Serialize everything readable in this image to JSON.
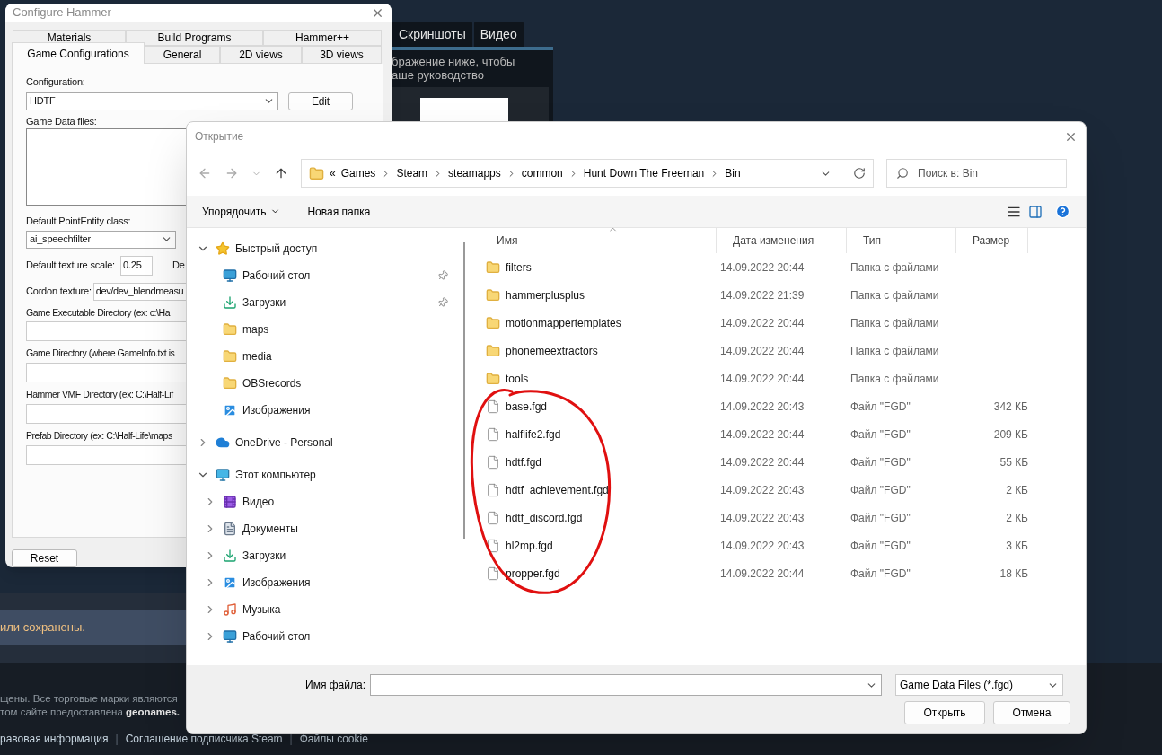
{
  "background_page": {
    "tabs": [
      {
        "label": "Скриншоты"
      },
      {
        "label": "Видео"
      }
    ],
    "hint_lines": [
      "бражение ниже, чтобы",
      "аше руководство"
    ],
    "notice": "или сохранены.",
    "footer_lines": [
      "щены. Все торговые марки являются",
      "том сайте предоставлена **geonames.**"
    ],
    "footer_links": [
      "равовая информация",
      "Соглашение подписчика Steam",
      "Файлы cookie"
    ],
    "separator": "|"
  },
  "hammer_window": {
    "title": "Configure Hammer",
    "tabs_row_1": [
      {
        "label": "Materials",
        "selected": false
      },
      {
        "label": "Build Programs",
        "selected": false
      },
      {
        "label": "Hammer++",
        "selected": false
      }
    ],
    "tabs_row_2": [
      {
        "label": "Game Configurations",
        "selected": true
      },
      {
        "label": "General",
        "selected": false
      },
      {
        "label": "2D views",
        "selected": false
      },
      {
        "label": "3D views",
        "selected": false
      }
    ],
    "configuration": {
      "label": "Configuration:",
      "value": "HDTF"
    },
    "edit_button": "Edit",
    "game_data_files_label": "Game Data files:",
    "point_entity": {
      "label": "Default PointEntity class:",
      "value": "ai_speechfilter"
    },
    "texture_scale": {
      "label": "Default texture scale:",
      "value": "0.25"
    },
    "next_label": "De",
    "cordon": {
      "label": "Cordon texture:",
      "value": "dev/dev_blendmeasu"
    },
    "directories": [
      {
        "label": "Game Executable Directory (ex: c:\\Ha"
      },
      {
        "label": "Game Directory (where GameInfo.txt is"
      },
      {
        "label": "Hammer VMF Directory (ex: C:\\Half-Lif"
      },
      {
        "label": "Prefab Directory (ex: C:\\Half-Life\\maps"
      }
    ],
    "reset_button": "Reset"
  },
  "dialog": {
    "title": "Открытие",
    "path_prefix": "«",
    "path": [
      "Games",
      "Steam",
      "steamapps",
      "common",
      "Hunt Down The Freeman",
      "Bin"
    ],
    "search_placeholder": "Поиск в: Bin",
    "organize": "Упорядочить",
    "new_folder": "Новая папка",
    "nav": [
      {
        "label": "Быстрый доступ",
        "kind": "star",
        "expanded": true,
        "children": [
          {
            "label": "Рабочий стол",
            "kind": "desktop",
            "pinned": true
          },
          {
            "label": "Загрузки",
            "kind": "download",
            "pinned": true
          },
          {
            "label": "maps",
            "kind": "folder",
            "pinned": false
          },
          {
            "label": "media",
            "kind": "folder",
            "pinned": false
          },
          {
            "label": "OBSrecords",
            "kind": "folder",
            "pinned": false
          },
          {
            "label": "Изображения",
            "kind": "pictures",
            "pinned": false
          }
        ]
      },
      {
        "label": "OneDrive - Personal",
        "kind": "cloud",
        "expanded": false
      },
      {
        "label": "Этот компьютер",
        "kind": "computer",
        "expanded": true,
        "children": [
          {
            "label": "Видео",
            "kind": "video",
            "expanded": false
          },
          {
            "label": "Документы",
            "kind": "documents",
            "expanded": false
          },
          {
            "label": "Загрузки",
            "kind": "download",
            "expanded": false
          },
          {
            "label": "Изображения",
            "kind": "pictures",
            "expanded": false
          },
          {
            "label": "Музыка",
            "kind": "music",
            "expanded": false
          },
          {
            "label": "Рабочий стол",
            "kind": "desktop",
            "expanded": false
          }
        ]
      }
    ],
    "columns": [
      "Имя",
      "Дата изменения",
      "Тип",
      "Размер"
    ],
    "files": [
      {
        "kind": "folder",
        "name": "filters",
        "date": "14.09.2022 20:44",
        "type": "Папка с файлами"
      },
      {
        "kind": "folder",
        "name": "hammerplusplus",
        "date": "14.09.2022 21:39",
        "type": "Папка с файлами"
      },
      {
        "kind": "folder",
        "name": "motionmappertemplates",
        "date": "14.09.2022 20:44",
        "type": "Папка с файлами"
      },
      {
        "kind": "folder",
        "name": "phonemeextractors",
        "date": "14.09.2022 20:44",
        "type": "Папка с файлами"
      },
      {
        "kind": "folder",
        "name": "tools",
        "date": "14.09.2022 20:44",
        "type": "Папка с файлами"
      },
      {
        "kind": "file",
        "name": "base.fgd",
        "date": "14.09.2022 20:43",
        "type": "Файл \"FGD\"",
        "size": "342 КБ"
      },
      {
        "kind": "file",
        "name": "halflife2.fgd",
        "date": "14.09.2022 20:44",
        "type": "Файл \"FGD\"",
        "size": "209 КБ"
      },
      {
        "kind": "file",
        "name": "hdtf.fgd",
        "date": "14.09.2022 20:44",
        "type": "Файл \"FGD\"",
        "size": "55 КБ"
      },
      {
        "kind": "file",
        "name": "hdtf_achievement.fgd",
        "date": "14.09.2022 20:43",
        "type": "Файл \"FGD\"",
        "size": "2 КБ"
      },
      {
        "kind": "file",
        "name": "hdtf_discord.fgd",
        "date": "14.09.2022 20:43",
        "type": "Файл \"FGD\"",
        "size": "2 КБ"
      },
      {
        "kind": "file",
        "name": "hl2mp.fgd",
        "date": "14.09.2022 20:43",
        "type": "Файл \"FGD\"",
        "size": "3 КБ"
      },
      {
        "kind": "file",
        "name": "propper.fgd",
        "date": "14.09.2022 20:44",
        "type": "Файл \"FGD\"",
        "size": "18 КБ"
      }
    ],
    "filename_label": "Имя файла:",
    "filter": "Game Data Files (*.fgd)",
    "open_button": "Открыть",
    "cancel_button": "Отмена"
  }
}
